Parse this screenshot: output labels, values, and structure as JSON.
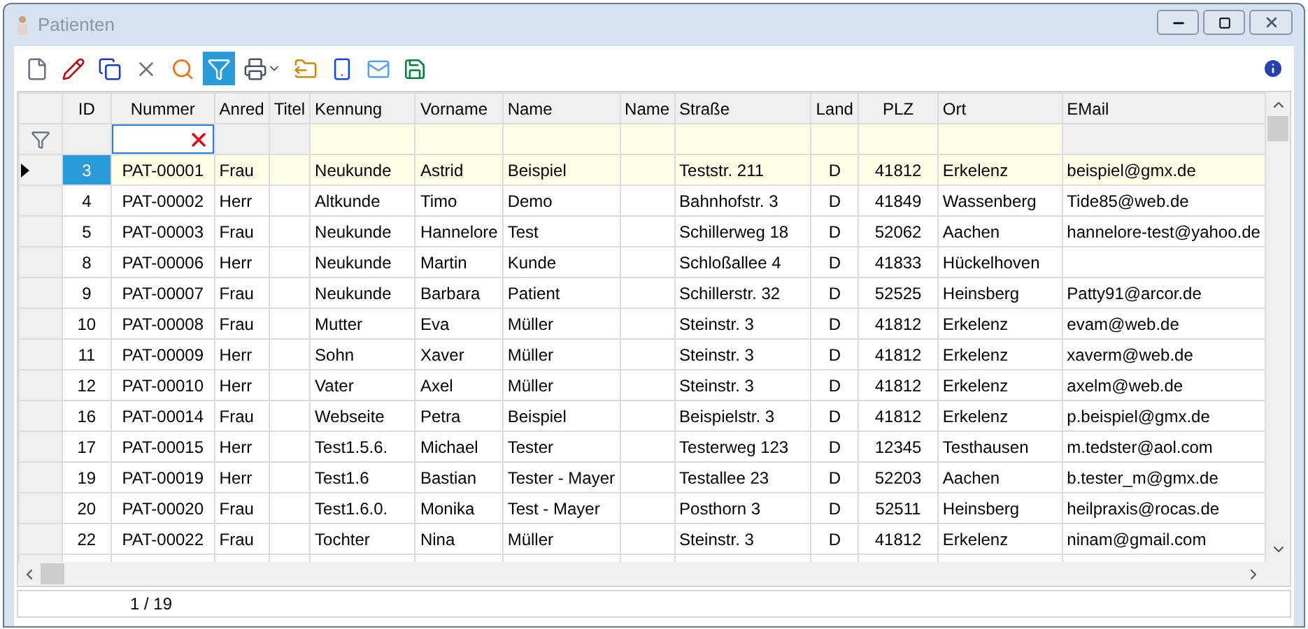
{
  "window": {
    "title": "Patienten"
  },
  "toolbar": [
    {
      "kind": "new",
      "selected": false
    },
    {
      "kind": "edit",
      "selected": false
    },
    {
      "kind": "copy",
      "selected": false
    },
    {
      "kind": "delete",
      "selected": false
    },
    {
      "kind": "search",
      "selected": false
    },
    {
      "kind": "filter",
      "selected": true
    },
    {
      "kind": "print",
      "selected": false
    },
    {
      "kind": "export",
      "selected": false
    },
    {
      "kind": "phone",
      "selected": false
    },
    {
      "kind": "mail",
      "selected": false
    },
    {
      "kind": "save",
      "selected": false
    }
  ],
  "table": {
    "columns": [
      "ID",
      "Nummer",
      "Anred",
      "Titel",
      "Kennung",
      "Vorname",
      "Name",
      "Name",
      "Straße",
      "Land",
      "PLZ",
      "Ort",
      "EMail"
    ],
    "rows": [
      {
        "selected": true,
        "cells": [
          "3",
          "PAT-00001",
          "Frau",
          "",
          "Neukunde",
          "Astrid",
          "Beispiel",
          "",
          "Teststr. 211",
          "D",
          "41812",
          "Erkelenz",
          "beispiel@gmx.de"
        ]
      },
      {
        "selected": false,
        "cells": [
          "4",
          "PAT-00002",
          "Herr",
          "",
          "Altkunde",
          "Timo",
          "Demo",
          "",
          "Bahnhofstr. 3",
          "D",
          "41849",
          "Wassenberg",
          "Tide85@web.de"
        ]
      },
      {
        "selected": false,
        "cells": [
          "5",
          "PAT-00003",
          "Frau",
          "",
          "Neukunde",
          "Hannelore",
          "Test",
          "",
          "Schillerweg 18",
          "D",
          "52062",
          "Aachen",
          "hannelore-test@yahoo.de"
        ]
      },
      {
        "selected": false,
        "cells": [
          "8",
          "PAT-00006",
          "Herr",
          "",
          "Neukunde",
          "Martin",
          "Kunde",
          "",
          "Schloßallee 4",
          "D",
          "41833",
          "Hückelhoven",
          ""
        ]
      },
      {
        "selected": false,
        "cells": [
          "9",
          "PAT-00007",
          "Frau",
          "",
          "Neukunde",
          "Barbara",
          "Patient",
          "",
          "Schillerstr. 32",
          "D",
          "52525",
          "Heinsberg",
          "Patty91@arcor.de"
        ]
      },
      {
        "selected": false,
        "cells": [
          "10",
          "PAT-00008",
          "Frau",
          "",
          "Mutter",
          "Eva",
          "Müller",
          "",
          "Steinstr. 3",
          "D",
          "41812",
          "Erkelenz",
          "evam@web.de"
        ]
      },
      {
        "selected": false,
        "cells": [
          "11",
          "PAT-00009",
          "Herr",
          "",
          "Sohn",
          "Xaver",
          "Müller",
          "",
          "Steinstr. 3",
          "D",
          "41812",
          "Erkelenz",
          "xaverm@web.de"
        ]
      },
      {
        "selected": false,
        "cells": [
          "12",
          "PAT-00010",
          "Herr",
          "",
          "Vater",
          "Axel",
          "Müller",
          "",
          "Steinstr. 3",
          "D",
          "41812",
          "Erkelenz",
          "axelm@web.de"
        ]
      },
      {
        "selected": false,
        "cells": [
          "16",
          "PAT-00014",
          "Frau",
          "",
          "Webseite",
          "Petra",
          "Beispiel",
          "",
          "Beispielstr. 3",
          "D",
          "41812",
          "Erkelenz",
          "p.beispiel@gmx.de"
        ]
      },
      {
        "selected": false,
        "cells": [
          "17",
          "PAT-00015",
          "Herr",
          "",
          "Test1.5.6.",
          "Michael",
          "Tester",
          "",
          "Testerweg 123",
          "D",
          "12345",
          "Testhausen",
          "m.tedster@aol.com"
        ]
      },
      {
        "selected": false,
        "cells": [
          "19",
          "PAT-00019",
          "Herr",
          "",
          "Test1.6",
          "Bastian",
          "Tester - Mayer",
          "",
          "Testallee 23",
          "D",
          "52203",
          "Aachen",
          "b.tester_m@gmx.de"
        ]
      },
      {
        "selected": false,
        "cells": [
          "20",
          "PAT-00020",
          "Frau",
          "",
          "Test1.6.0.",
          "Monika",
          "Test - Mayer",
          "",
          "Posthorn 3",
          "D",
          "52511",
          "Heinsberg",
          "heilpraxis@rocas.de"
        ]
      },
      {
        "selected": false,
        "cells": [
          "22",
          "PAT-00022",
          "Frau",
          "",
          "Tochter",
          "Nina",
          "Müller",
          "",
          "Steinstr. 3",
          "D",
          "41812",
          "Erkelenz",
          "ninam@gmail.com"
        ]
      }
    ]
  },
  "status_bar": {
    "position": "1 / 19"
  }
}
